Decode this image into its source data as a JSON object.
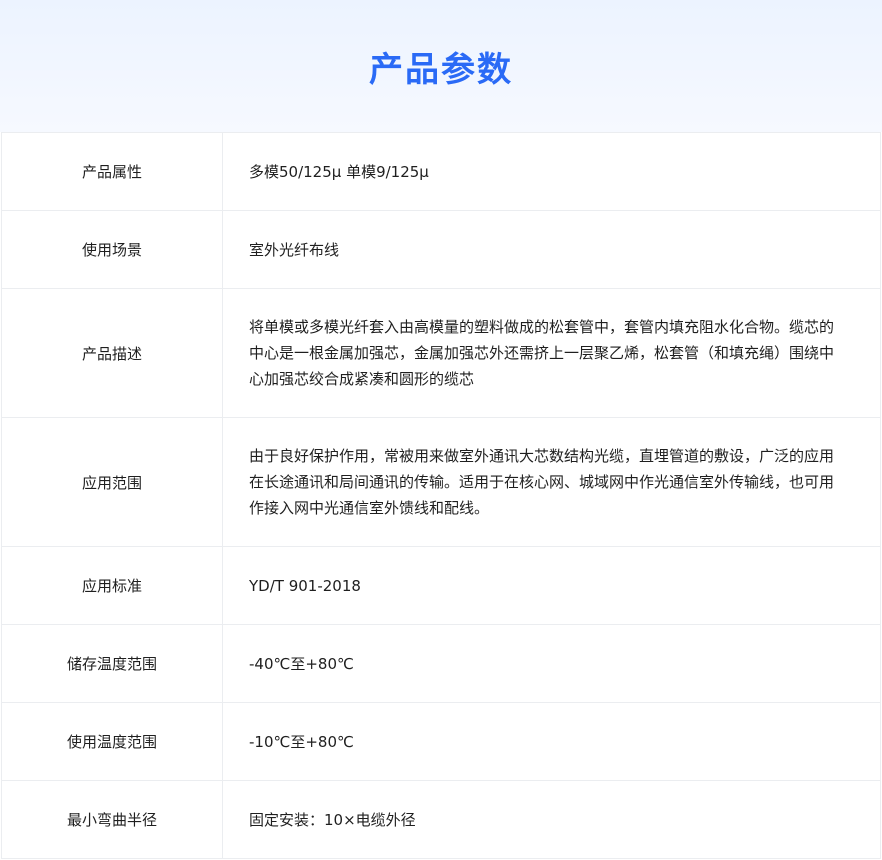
{
  "title": "产品参数",
  "rows": [
    {
      "label": "产品属性",
      "value": "多模50/125μ 单模9/125μ"
    },
    {
      "label": "使用场景",
      "value": "室外光纤布线"
    },
    {
      "label": "产品描述",
      "value": "将单模或多模光纤套入由高模量的塑料做成的松套管中，套管内填充阻水化合物。缆芯的中心是一根金属加强芯，金属加强芯外还需挤上一层聚乙烯，松套管（和填充绳）围绕中心加强芯绞合成紧凑和圆形的缆芯"
    },
    {
      "label": "应用范围",
      "value": "由于良好保护作用，常被用来做室外通讯大芯数结构光缆，直埋管道的敷设，广泛的应用在长途通讯和局间通讯的传输。适用于在核心网、城域网中作光通信室外传输线，也可用作接入网中光通信室外馈线和配线。"
    },
    {
      "label": "应用标准",
      "value": "YD/T 901-2018"
    },
    {
      "label": "储存温度范围",
      "value": "-40℃至+80℃"
    },
    {
      "label": "使用温度范围",
      "value": "-10℃至+80℃"
    },
    {
      "label": "最小弯曲半径",
      "value": "固定安装：10×电缆外径"
    }
  ]
}
